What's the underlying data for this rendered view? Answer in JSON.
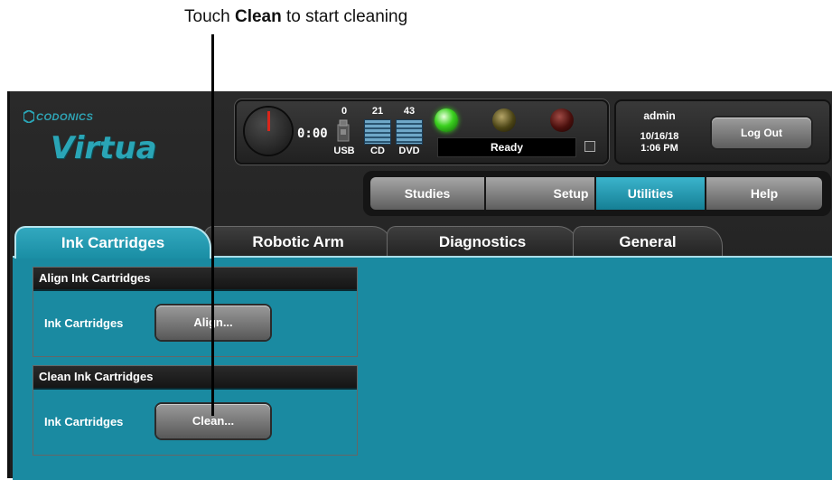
{
  "callout": {
    "prefix": "Touch ",
    "bold": "Clean",
    "suffix": " to start cleaning"
  },
  "logo": {
    "top": "CODONICS",
    "main": "Virtua"
  },
  "status": {
    "timer": "0:00",
    "usb_count": "0",
    "cd_count": "21",
    "dvd_count": "43",
    "usb_label": "USB",
    "cd_label": "CD",
    "dvd_label": "DVD",
    "state": "Ready",
    "leds": {
      "green": "#3bd11f",
      "yellow": "#4b4415",
      "red": "#4a0f0c"
    }
  },
  "user": {
    "name": "admin",
    "date": "10/16/18",
    "time": "1:06 PM",
    "logout": "Log Out"
  },
  "nav": {
    "studies": "Studies",
    "setup": "Setup",
    "utilities": "Utilities",
    "help": "Help",
    "active": "Utilities"
  },
  "tabs": {
    "ink": "Ink Cartridges",
    "robotic": "Robotic Arm",
    "diagnostics": "Diagnostics",
    "general": "General",
    "active": "Ink Cartridges"
  },
  "groups": {
    "align": {
      "title": "Align Ink Cartridges",
      "label": "Ink Cartridges",
      "button": "Align..."
    },
    "clean": {
      "title": "Clean Ink Cartridges",
      "label": "Ink Cartridges",
      "button": "Clean..."
    }
  },
  "colors": {
    "accent": "#1a8aa1",
    "logo": "#2aa5b6"
  },
  "icons": [
    "timer-dial-icon",
    "usb-icon",
    "cd-stack-icon",
    "dvd-stack-icon",
    "status-led-icon",
    "hexagon-logo-icon",
    "expand-icon"
  ]
}
